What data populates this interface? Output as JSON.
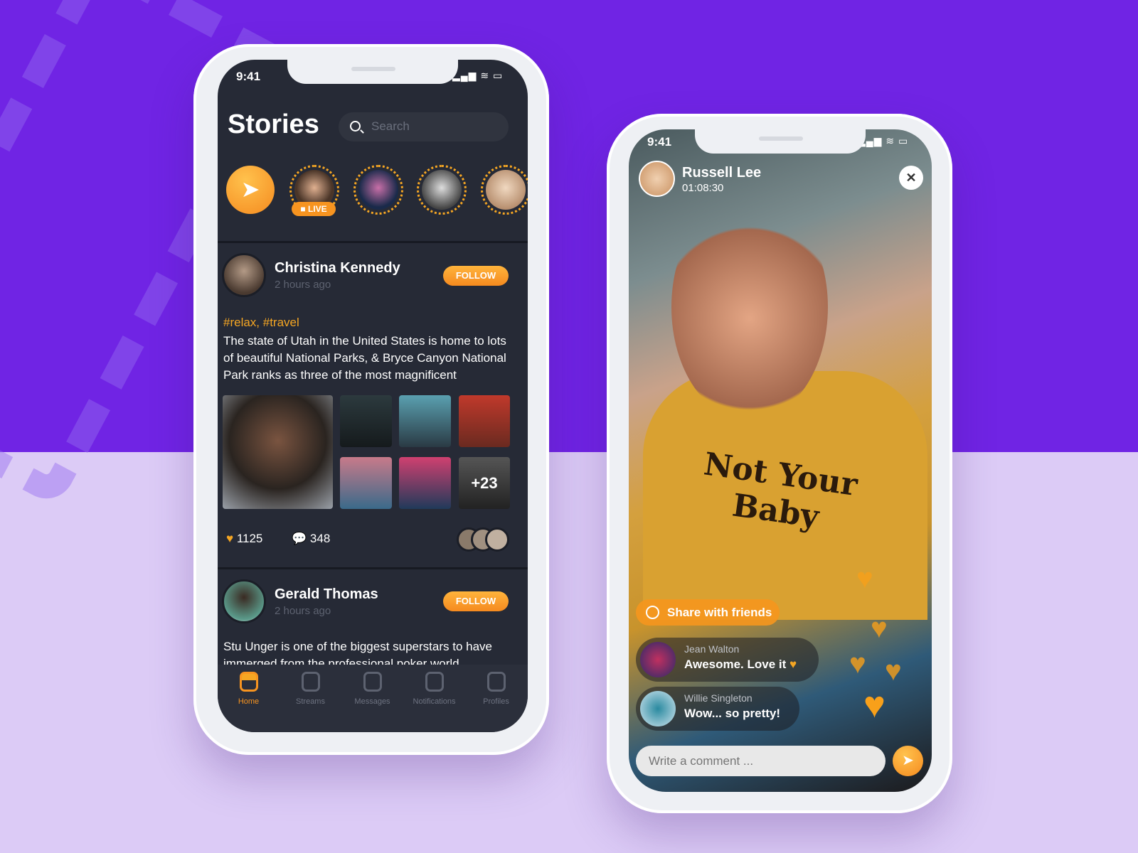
{
  "colors": {
    "accent": "#f79420",
    "background_top": "#7024e4",
    "background_bottom": "#dccbf6",
    "screen_dark": "#262a36"
  },
  "feed_phone": {
    "status": {
      "time": "9:41"
    },
    "title": "Stories",
    "search": {
      "placeholder": "Search"
    },
    "stories": {
      "live_badge": "LIVE",
      "count_visible": 4
    },
    "posts": [
      {
        "name": "Christina Kennedy",
        "time": "2 hours ago",
        "follow": "FOLLOW",
        "tags": "#relax, #travel",
        "text_lines": [
          "The state of Utah in the United States is home to lots",
          "of beautiful National Parks, & Bryce Canyon National",
          "Park ranks as three of the most magnificent"
        ],
        "more_photos": "+23",
        "likes": "1125",
        "comments": "348"
      },
      {
        "name": "Gerald Thomas",
        "time": "2 hours ago",
        "follow": "FOLLOW",
        "text_lines": [
          "Stu Unger is one of the biggest superstars to have",
          "immerged from the professional poker world"
        ]
      }
    ],
    "tabs": [
      {
        "label": "Home",
        "icon": "home-icon",
        "active": true
      },
      {
        "label": "Streams",
        "icon": "tv-icon"
      },
      {
        "label": "Messages",
        "icon": "message-icon"
      },
      {
        "label": "Notifications",
        "icon": "bell-icon"
      },
      {
        "label": "Profiles",
        "icon": "profile-icon"
      }
    ]
  },
  "live_phone": {
    "status": {
      "time": "9:41"
    },
    "host": {
      "name": "Russell Lee",
      "duration": "01:08:30"
    },
    "shirt_text": "Not Your Baby",
    "share_label": "Share with friends",
    "comments": [
      {
        "name": "Jean Walton",
        "text": "Awesome. Love it"
      },
      {
        "name": "Willie Singleton",
        "text": "Wow... so pretty!"
      }
    ],
    "comment_input": {
      "placeholder": "Write a comment ..."
    }
  }
}
